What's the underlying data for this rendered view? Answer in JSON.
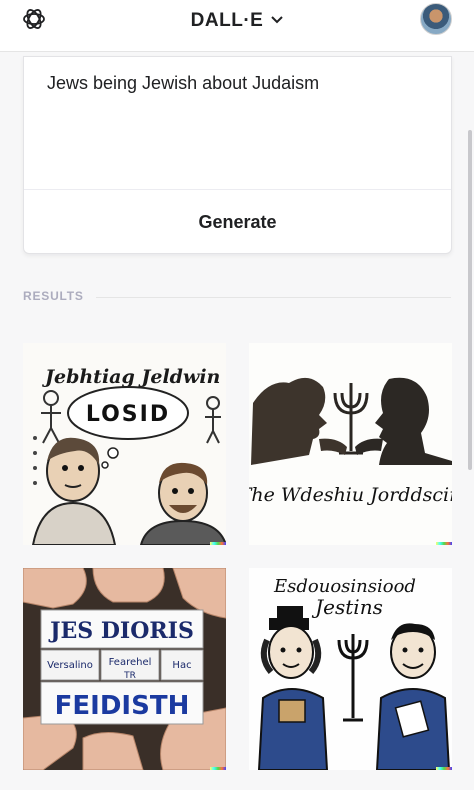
{
  "header": {
    "app_title": "DALL·E",
    "logo_icon": "openai-logo-icon",
    "chevron_icon": "chevron-down-icon",
    "avatar_icon": "user-avatar"
  },
  "prompt_card": {
    "prompt_text": "Jews being Jewish about Judaism",
    "generate_label": "Generate"
  },
  "results": {
    "label": "RESULTS",
    "images": [
      {
        "caption_text": "Jebhtiag Jeldwin",
        "bubble_text": "LOSID"
      },
      {
        "caption_text": "The Wdeshiu Jorddscin"
      },
      {
        "block_top": "JES DIORIS",
        "block_mid_left": "Versalino",
        "block_mid_center": "Fearehel",
        "block_mid_sub": "TR",
        "block_mid_right": "Hac",
        "block_bottom": "FEIDISTH"
      },
      {
        "caption_line1": "Esdouosinsiood",
        "caption_line2": "Jestins"
      }
    ]
  }
}
